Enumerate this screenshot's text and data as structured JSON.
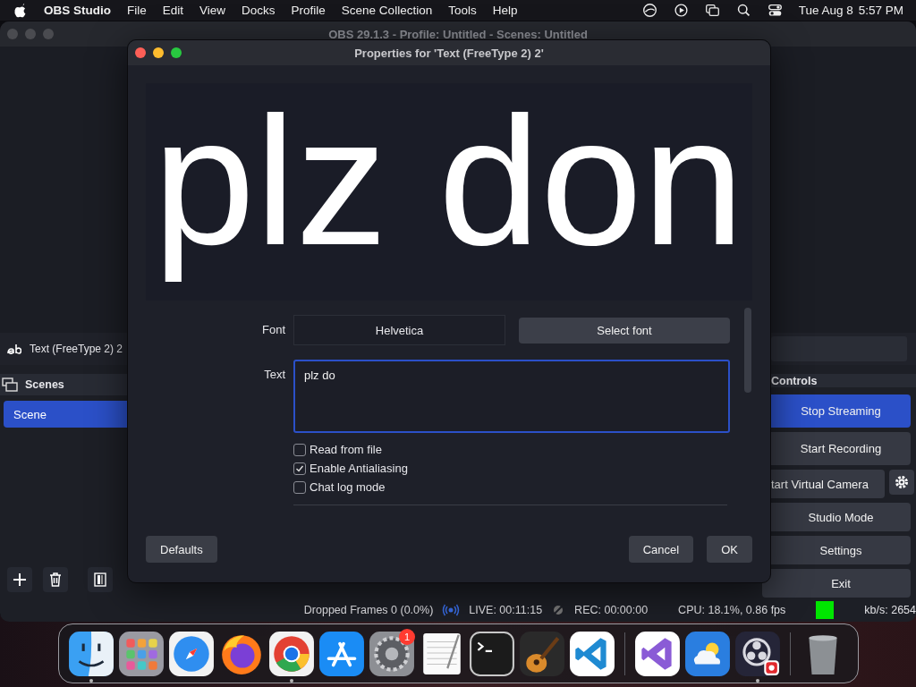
{
  "menu_bar": {
    "app_name": "OBS Studio",
    "menus": [
      "File",
      "Edit",
      "View",
      "Docks",
      "Profile",
      "Scene Collection",
      "Tools",
      "Help"
    ],
    "date": "Tue Aug 8",
    "time": "5:57 PM"
  },
  "main_window": {
    "title": "OBS 29.1.3 - Profile: Untitled - Scenes: Untitled",
    "source_bar": {
      "label": "Text (FreeType 2) 2"
    },
    "scenes": {
      "title": "Scenes",
      "items": [
        {
          "label": "Scene",
          "selected": true
        }
      ]
    },
    "controls": {
      "title": "Controls",
      "buttons": [
        {
          "label": "Stop Streaming",
          "kind": "plain",
          "active": true
        },
        {
          "label": "Start Recording",
          "kind": "plain",
          "active": false
        },
        {
          "label": "tart Virtual Camera",
          "kind": "with_settings",
          "active": false
        },
        {
          "label": "Studio Mode",
          "kind": "plain",
          "active": false
        },
        {
          "label": "Settings",
          "kind": "plain",
          "active": false
        },
        {
          "label": "Exit",
          "kind": "plain",
          "active": false
        }
      ]
    },
    "status_bar": {
      "dropped_frames": "Dropped Frames 0 (0.0%)",
      "live": "LIVE: 00:11:15",
      "rec": "REC: 00:00:00",
      "cpu": "CPU: 18.1%, 0.86 fps",
      "kbps": "kb/s: 2654"
    }
  },
  "dialog": {
    "title": "Properties for 'Text (FreeType 2) 2'",
    "preview_text": "plz don",
    "font": {
      "label": "Font",
      "value": "Helvetica",
      "button": "Select font"
    },
    "text": {
      "label": "Text",
      "value": "plz do"
    },
    "checkboxes": [
      {
        "label": "Read from file",
        "checked": false
      },
      {
        "label": "Enable Antialiasing",
        "checked": true
      },
      {
        "label": "Chat log mode",
        "checked": false
      }
    ],
    "buttons": {
      "defaults": "Defaults",
      "cancel": "Cancel",
      "ok": "OK"
    }
  },
  "dock": {
    "sections": [
      {
        "items": [
          {
            "kind": "finder",
            "running": true
          },
          {
            "kind": "launchpad",
            "running": false
          },
          {
            "kind": "safari",
            "running": false
          },
          {
            "kind": "firefox",
            "running": false
          },
          {
            "kind": "chrome",
            "running": true
          },
          {
            "kind": "appstore",
            "running": false
          },
          {
            "kind": "settings",
            "running": false,
            "badge": "1"
          },
          {
            "kind": "textedit",
            "running": false
          },
          {
            "kind": "terminal",
            "running": false
          },
          {
            "kind": "garageband",
            "running": false
          },
          {
            "kind": "vscode",
            "running": false
          }
        ]
      },
      {
        "items": [
          {
            "kind": "visualstudio",
            "running": false
          },
          {
            "kind": "weather",
            "running": false
          },
          {
            "kind": "obs",
            "running": true
          }
        ]
      },
      {
        "items": [
          {
            "kind": "trash",
            "running": false
          }
        ]
      }
    ]
  }
}
